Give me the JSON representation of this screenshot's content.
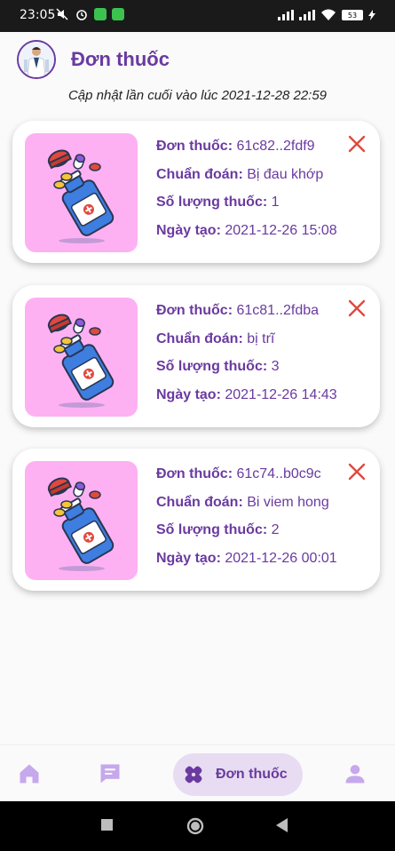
{
  "status_bar": {
    "time": "23:05",
    "battery": "53"
  },
  "header": {
    "title": "Đơn thuốc",
    "last_updated": "Cập nhật lần cuối vào lúc 2021-12-28 22:59"
  },
  "labels": {
    "prescription": "Đơn thuốc:",
    "diagnosis": "Chuẩn đoán:",
    "quantity": "Số lượng thuốc:",
    "created": "Ngày tạo:"
  },
  "prescriptions": [
    {
      "id": "61c82..2fdf9",
      "diagnosis": "Bị đau khớp",
      "quantity": "1",
      "created": "2021-12-26 15:08"
    },
    {
      "id": "61c81..2fdba",
      "diagnosis": "bị trĩ",
      "quantity": "3",
      "created": "2021-12-26 14:43"
    },
    {
      "id": "61c74..b0c9c",
      "diagnosis": "Bi viem hong",
      "quantity": "2",
      "created": "2021-12-26 00:01"
    }
  ],
  "bottom_nav": {
    "items": [
      {
        "name": "home",
        "icon": "home-icon"
      },
      {
        "name": "messages",
        "icon": "chat-icon"
      },
      {
        "name": "prescriptions",
        "icon": "bandage-icon",
        "label": "Đơn thuốc",
        "active": true
      },
      {
        "name": "profile",
        "icon": "person-icon"
      }
    ]
  },
  "colors": {
    "primary": "#6a3aa0",
    "danger": "#e0493d",
    "thumb_bg": "#fdb1f3",
    "nav_active_bg": "#e7dcf1"
  }
}
